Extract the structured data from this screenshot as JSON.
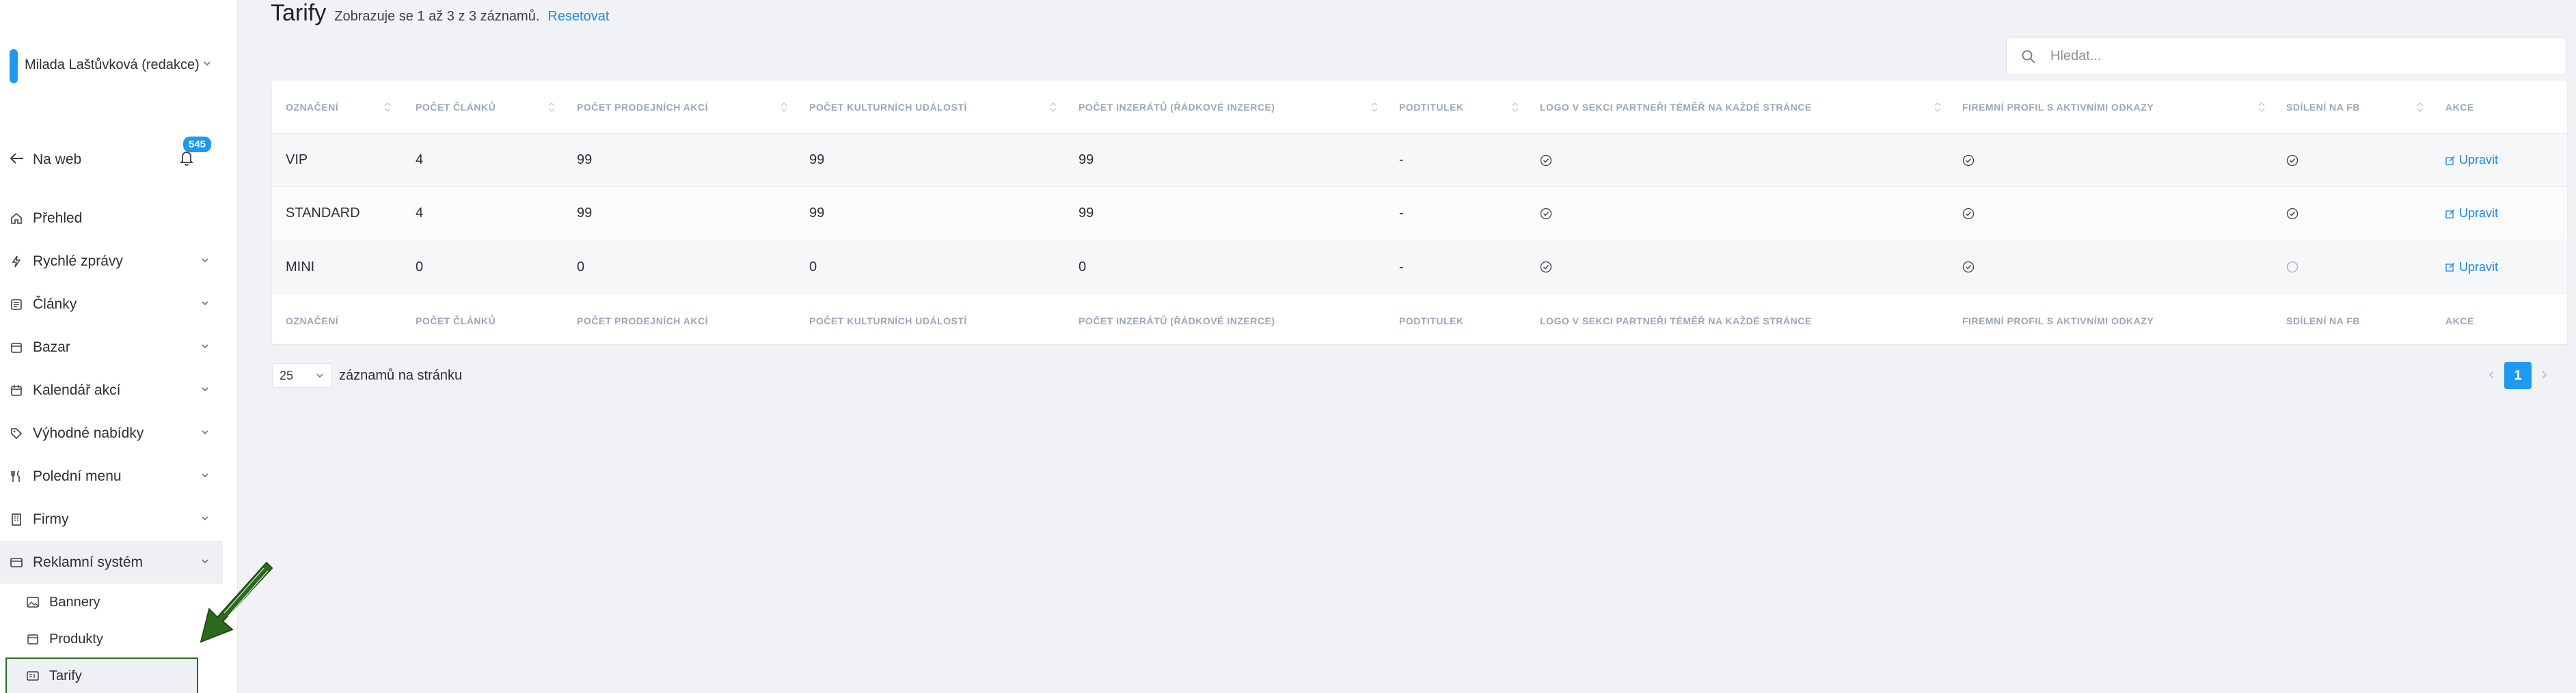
{
  "sidebar": {
    "user_name": "Milada Laštůvková (redakce)",
    "web_link": "Na web",
    "notifications_count": "545",
    "items": [
      {
        "label": "Přehled",
        "icon": "home-icon"
      },
      {
        "label": "Rychlé zprávy",
        "icon": "bolt-icon"
      },
      {
        "label": "Články",
        "icon": "article-icon"
      },
      {
        "label": "Bazar",
        "icon": "box-icon"
      },
      {
        "label": "Kalendář akcí",
        "icon": "calendar-icon"
      },
      {
        "label": "Výhodné nabídky",
        "icon": "tag-icon"
      },
      {
        "label": "Polední menu",
        "icon": "cutlery-icon"
      },
      {
        "label": "Firmy",
        "icon": "building-icon"
      },
      {
        "label": "Reklamní systém",
        "icon": "ad-icon"
      }
    ],
    "subitems": [
      {
        "label": "Bannery",
        "icon": "image-icon"
      },
      {
        "label": "Produkty",
        "icon": "package-icon"
      },
      {
        "label": "Tarify",
        "icon": "tariff-icon"
      }
    ]
  },
  "header": {
    "title": "Tarify",
    "subtitle": "Zobrazuje se 1 až 3 z 3 záznamů.",
    "reset": "Resetovat"
  },
  "search": {
    "placeholder": "Hledat..."
  },
  "table": {
    "columns": [
      "OZNAČENÍ",
      "POČET ČLÁNKŮ",
      "POČET PRODEJNÍCH AKCÍ",
      "POČET KULTURNÍCH UDÁLOSTÍ",
      "POČET INZERÁTŮ (ŘÁDKOVÉ INZERCE)",
      "PODTITULEK",
      "LOGO V SEKCI PARTNEŘI TÉMĚŘ NA KAŽDÉ STRÁNCE",
      "FIREMNÍ PROFIL S AKTIVNÍMI ODKAZY",
      "SDÍLENÍ NA FB",
      "AKCE"
    ],
    "rows": [
      {
        "name": "VIP",
        "articles": "4",
        "sales": "99",
        "culture": "99",
        "ads": "99",
        "subtitle": "-",
        "logo": true,
        "profile": true,
        "fb": true,
        "action": "Upravit"
      },
      {
        "name": "STANDARD",
        "articles": "4",
        "sales": "99",
        "culture": "99",
        "ads": "99",
        "subtitle": "-",
        "logo": true,
        "profile": true,
        "fb": true,
        "action": "Upravit"
      },
      {
        "name": "MINI",
        "articles": "0",
        "sales": "0",
        "culture": "0",
        "ads": "0",
        "subtitle": "-",
        "logo": true,
        "profile": true,
        "fb": false,
        "action": "Upravit"
      }
    ]
  },
  "pagination": {
    "per_page": "25",
    "per_page_label": "záznamů na stránku",
    "current_page": "1"
  },
  "colors": {
    "accent": "#1e9bf0",
    "link": "#1e88e5",
    "annotation": "#2d6a1e"
  }
}
